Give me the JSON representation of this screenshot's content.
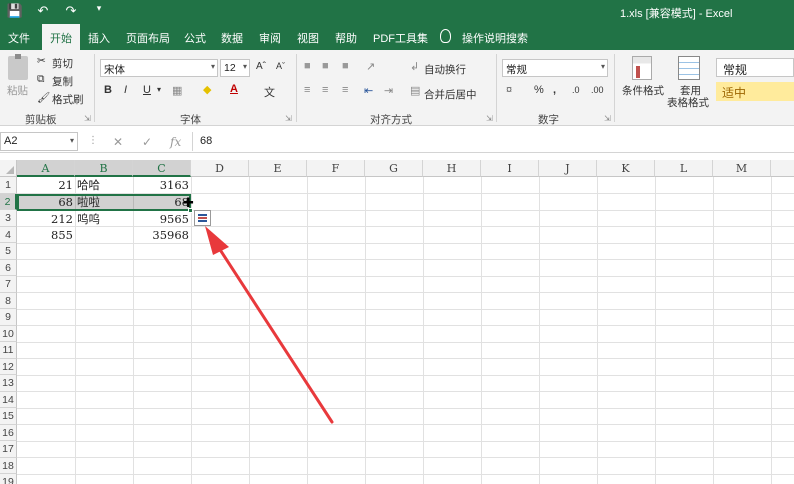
{
  "titlebar": {
    "title": "1.xls  [兼容模式]  -  Excel"
  },
  "tabs": [
    "文件",
    "开始",
    "插入",
    "页面布局",
    "公式",
    "数据",
    "审阅",
    "视图",
    "帮助",
    "PDF工具集"
  ],
  "tellme": "操作说明搜索",
  "ribbon": {
    "clipboard": {
      "paste": "粘贴",
      "cut": "剪切",
      "copy": "复制",
      "format_painter": "格式刷",
      "label": "剪贴板"
    },
    "font": {
      "name": "宋体",
      "size": "12",
      "label": "字体"
    },
    "alignment": {
      "wrap": "自动换行",
      "merge": "合并后居中",
      "label": "对齐方式"
    },
    "number": {
      "format": "常规",
      "label": "数字"
    },
    "styles": {
      "conditional": "条件格式",
      "table_format_1": "套用",
      "table_format_2": "表格格式",
      "normal": "常规",
      "neutral": "适中"
    }
  },
  "formula_bar": {
    "name_box": "A2",
    "value": "68"
  },
  "grid": {
    "columns": [
      "A",
      "B",
      "C",
      "D",
      "E",
      "F",
      "G",
      "H",
      "I",
      "J",
      "K",
      "L",
      "M"
    ],
    "rows": [
      "1",
      "2",
      "3",
      "4",
      "5",
      "6",
      "7",
      "8",
      "9",
      "10",
      "11",
      "12",
      "13",
      "14",
      "15",
      "16",
      "17",
      "18",
      "19"
    ],
    "data": [
      {
        "a": "21",
        "b": "哈哈",
        "c": "3163"
      },
      {
        "a": "68",
        "b": "啦啦",
        "c": "68"
      },
      {
        "a": "212",
        "b": "呜呜",
        "c": "9565"
      },
      {
        "a": "855",
        "b": "",
        "c": "35968"
      }
    ]
  },
  "colors": {
    "accent": "#217346",
    "annotation_arrow": "#e8393c"
  }
}
